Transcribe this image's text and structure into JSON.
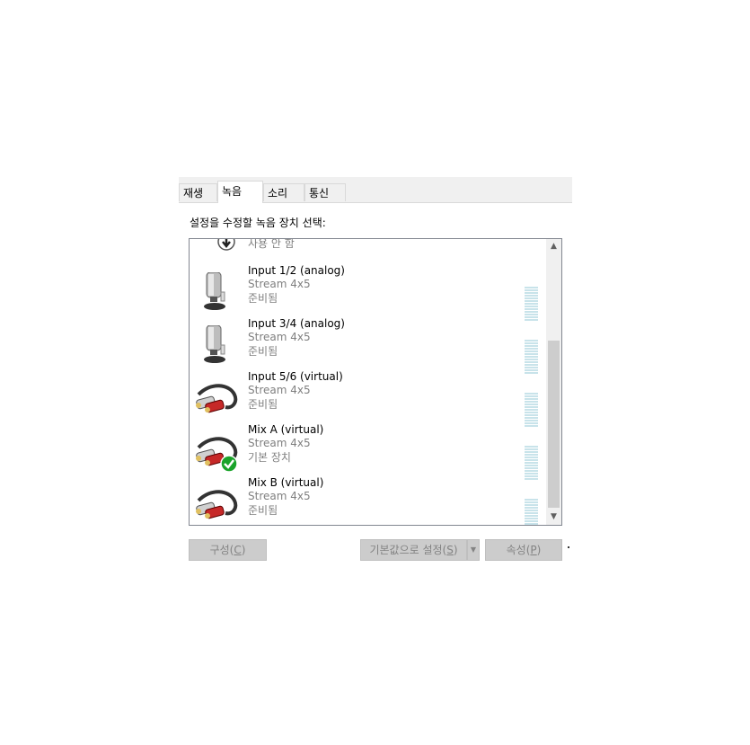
{
  "tabs": [
    {
      "label": "재생",
      "active": false
    },
    {
      "label": "녹음",
      "active": true
    },
    {
      "label": "소리",
      "active": false
    },
    {
      "label": "통신",
      "active": false
    }
  ],
  "prompt": "설정을 수정할 녹음 장치 선택:",
  "partial_item": {
    "status": "사용 안 함",
    "icon": "arrow-down-badge-icon"
  },
  "devices": [
    {
      "name": "Input 1/2 (analog)",
      "sub": "Stream 4x5",
      "status": "준비됨",
      "icon": "microphone-icon",
      "default": false
    },
    {
      "name": "Input 3/4 (analog)",
      "sub": "Stream 4x5",
      "status": "준비됨",
      "icon": "microphone-icon",
      "default": false
    },
    {
      "name": "Input 5/6 (virtual)",
      "sub": "Stream 4x5",
      "status": "준비됨",
      "icon": "rca-cable-icon",
      "default": false
    },
    {
      "name": "Mix A (virtual)",
      "sub": "Stream 4x5",
      "status": "기본 장치",
      "icon": "rca-cable-icon",
      "default": true
    },
    {
      "name": "Mix B (virtual)",
      "sub": "Stream 4x5",
      "status": "준비됨",
      "icon": "rca-cable-icon",
      "default": false
    }
  ],
  "buttons": {
    "configure": {
      "label": "구성(",
      "key": "C",
      "end": ")"
    },
    "set_default": {
      "label": "기본값으로 설정(",
      "key": "S",
      "end": ")"
    },
    "properties": {
      "label": "속성(",
      "key": "P",
      "end": ")"
    }
  },
  "colors": {
    "meter": "#c8e3ea",
    "button_bg": "#cccccc",
    "check": "#1aa32a"
  }
}
